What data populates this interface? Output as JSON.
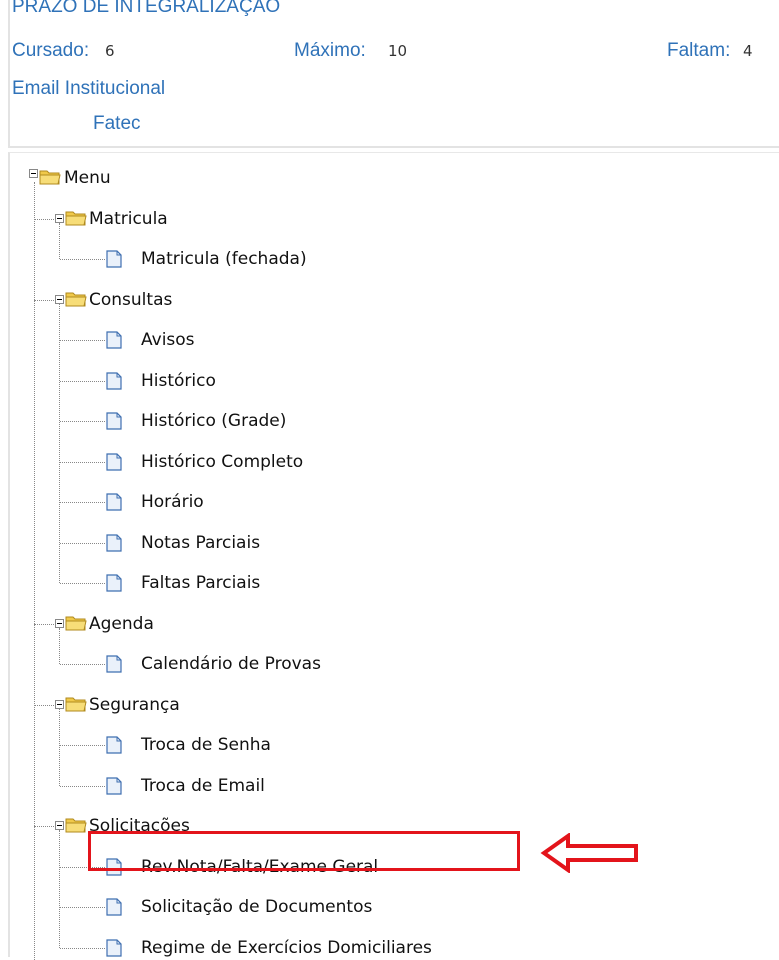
{
  "header": {
    "title": "PRAZO DE INTEGRALIZAÇÃO",
    "cursado_label": "Cursado:",
    "cursado_value": "6",
    "maximo_label": "Máximo:",
    "maximo_value": "10",
    "faltam_label": "Faltam:",
    "faltam_value": "4",
    "email_label": "Email Institucional",
    "institution": "Fatec"
  },
  "tree": {
    "root": "Menu",
    "groups": [
      {
        "label": "Matricula",
        "items": [
          "Matricula (fechada)"
        ]
      },
      {
        "label": "Consultas",
        "items": [
          "Avisos",
          "Histórico",
          "Histórico (Grade)",
          "Histórico Completo",
          "Horário",
          "Notas Parciais",
          "Faltas Parciais"
        ]
      },
      {
        "label": "Agenda",
        "items": [
          "Calendário de Provas"
        ]
      },
      {
        "label": "Segurança",
        "items": [
          "Troca de Senha",
          "Troca de Email"
        ]
      },
      {
        "label": "Solicitações",
        "items": [
          "Rev.Nota/Falta/Exame Geral",
          "Solicitação de Documentos",
          "Regime de Exercícios Domiciliares"
        ]
      }
    ]
  },
  "highlight": {
    "item": "Regime de Exercícios Domiciliares",
    "color": "#e3141b"
  },
  "colors": {
    "header_text": "#2f72b8",
    "folder": "#f3cf4a",
    "page": "#dbe7f5"
  }
}
